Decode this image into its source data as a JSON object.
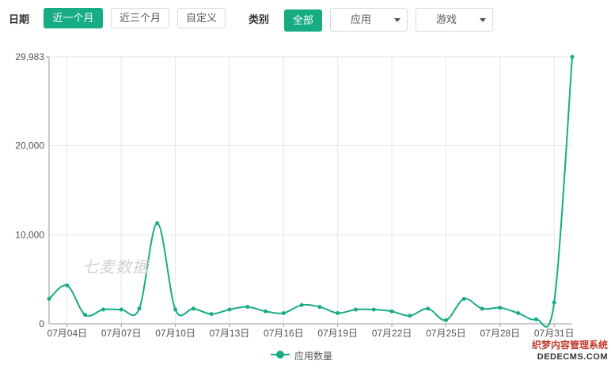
{
  "filters": {
    "date_label": "日期",
    "date_buttons": [
      "近一个月",
      "近三个月",
      "自定义"
    ],
    "category_label": "类别",
    "category_all": "全部",
    "select_app": "应用",
    "select_game": "游戏"
  },
  "watermark": "七麦数据",
  "corner_badge": {
    "line1": "织梦内容管理系统",
    "line2": "DEDECMS.COM"
  },
  "colors": {
    "accent": "#17ac82",
    "grid": "#e6e6e6",
    "axis": "#999999"
  },
  "chart_data": {
    "type": "line",
    "smooth": true,
    "ylim": [
      0,
      29983
    ],
    "yticks": [
      0,
      10000,
      20000,
      29983
    ],
    "ytick_labels": [
      "0",
      "10,000",
      "20,000",
      "29,983"
    ],
    "xtick_labels": [
      "07月04日",
      "07月07日",
      "07月10日",
      "07月13日",
      "07月16日",
      "07月19日",
      "07月22日",
      "07月25日",
      "07月28日",
      "07月31日"
    ],
    "grid": true,
    "legend_position": "bottom-center",
    "series": [
      {
        "name": "应用数量",
        "x": [
          "07月03日",
          "07月04日",
          "07月05日",
          "07月06日",
          "07月07日",
          "07月08日",
          "07月09日",
          "07月10日",
          "07月11日",
          "07月12日",
          "07月13日",
          "07月14日",
          "07月15日",
          "07月16日",
          "07月17日",
          "07月18日",
          "07月19日",
          "07月20日",
          "07月21日",
          "07月22日",
          "07月23日",
          "07月24日",
          "07月25日",
          "07月26日",
          "07月27日",
          "07月28日",
          "07月29日",
          "07月30日",
          "07月31日",
          "08月01日"
        ],
        "values": [
          2800,
          4300,
          1000,
          1600,
          1600,
          1700,
          11300,
          1600,
          1700,
          1100,
          1600,
          1900,
          1400,
          1200,
          2100,
          1900,
          1200,
          1600,
          1600,
          1400,
          900,
          1700,
          400,
          2800,
          1700,
          1800,
          1200,
          500,
          2400,
          29983
        ]
      }
    ]
  }
}
